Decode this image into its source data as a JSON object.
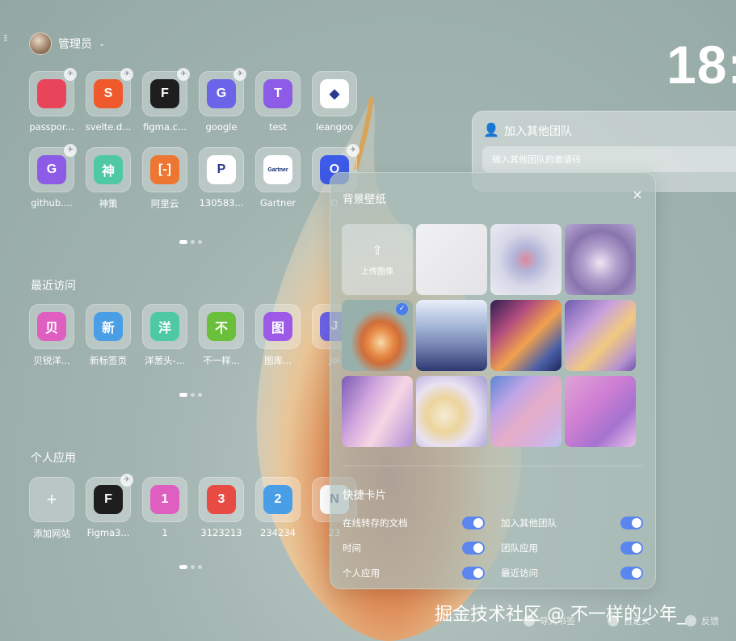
{
  "user": {
    "name": "管理员"
  },
  "clock": "18:",
  "top_apps": [
    {
      "label": "passpor...",
      "glyph": "",
      "icon": "passport-icon",
      "color": "#e8445a"
    },
    {
      "label": "svelte.d...",
      "glyph": "S",
      "icon": "svelte-icon",
      "color": "#f0592b"
    },
    {
      "label": "figma.c...",
      "glyph": "F",
      "icon": "figma-icon",
      "color": "#1e1e1e"
    },
    {
      "label": "google",
      "glyph": "G",
      "icon": "google-icon",
      "color": "#6b63e8"
    },
    {
      "label": "test",
      "glyph": "T",
      "icon": "test-icon",
      "color": "#8c5ce6"
    },
    {
      "label": "leangoo",
      "glyph": "◆",
      "icon": "leangoo-icon",
      "color": "#ffffff"
    },
    {
      "label": "github....",
      "glyph": "G",
      "icon": "github-icon",
      "color": "#8c5ce6"
    },
    {
      "label": "神策",
      "glyph": "神",
      "icon": "shence-icon",
      "color": "#4fc9a3"
    },
    {
      "label": "阿里云",
      "glyph": "[-]",
      "icon": "aliyun-icon",
      "color": "#ee7633"
    },
    {
      "label": "130583...",
      "glyph": "P",
      "icon": "paypal-icon",
      "color": "#ffffff"
    },
    {
      "label": "Gartner",
      "glyph": "Gartner",
      "icon": "gartner-icon",
      "color": "#ffffff"
    },
    {
      "label": "O",
      "glyph": "O",
      "icon": "o-icon",
      "color": "#3d5be8"
    }
  ],
  "recent": {
    "title": "最近访问",
    "apps": [
      {
        "label": "贝锐洋...",
        "glyph": "贝",
        "color": "#de5fc0"
      },
      {
        "label": "新标签页",
        "glyph": "新",
        "color": "#4a9ee6"
      },
      {
        "label": "洋葱头-...",
        "glyph": "洋",
        "color": "#4fc9a3"
      },
      {
        "label": "不一样...",
        "glyph": "不",
        "color": "#6ac03b"
      },
      {
        "label": "图库...",
        "glyph": "图",
        "color": "#9c5ae6"
      },
      {
        "label": "Joi",
        "glyph": "J",
        "color": "#6b63e8"
      }
    ]
  },
  "personal": {
    "title": "个人应用",
    "apps": [
      {
        "label": "添加网站",
        "glyph": "+",
        "color": "transparent"
      },
      {
        "label": "Figma3...",
        "glyph": "F",
        "color": "#1e1e1e"
      },
      {
        "label": "1",
        "glyph": "1",
        "color": "#de5fc0"
      },
      {
        "label": "3123213",
        "glyph": "3",
        "color": "#e84a44"
      },
      {
        "label": "234234",
        "glyph": "2",
        "color": "#4a9ee6"
      },
      {
        "label": "23",
        "glyph": "N",
        "color": "#ffffff"
      }
    ]
  },
  "team_card": {
    "title": "加入其他团队",
    "input_placeholder": "输入其他团队的邀请码"
  },
  "wallpaper_panel": {
    "title": "背景壁纸",
    "close": "×",
    "upload_label": "上传图像",
    "selected_index": 4,
    "quick_title": "快捷卡片",
    "toggles": [
      {
        "label": "在线转存的文档",
        "on": true
      },
      {
        "label": "加入其他团队",
        "on": true
      },
      {
        "label": "时间",
        "on": true
      },
      {
        "label": "团队应用",
        "on": true
      },
      {
        "label": "个人应用",
        "on": true
      },
      {
        "label": "最近访问",
        "on": true
      }
    ]
  },
  "watermark": "掘金技术社区 @ 不一样的少年_",
  "footer": [
    "导入书签",
    "自定义",
    "反馈"
  ]
}
